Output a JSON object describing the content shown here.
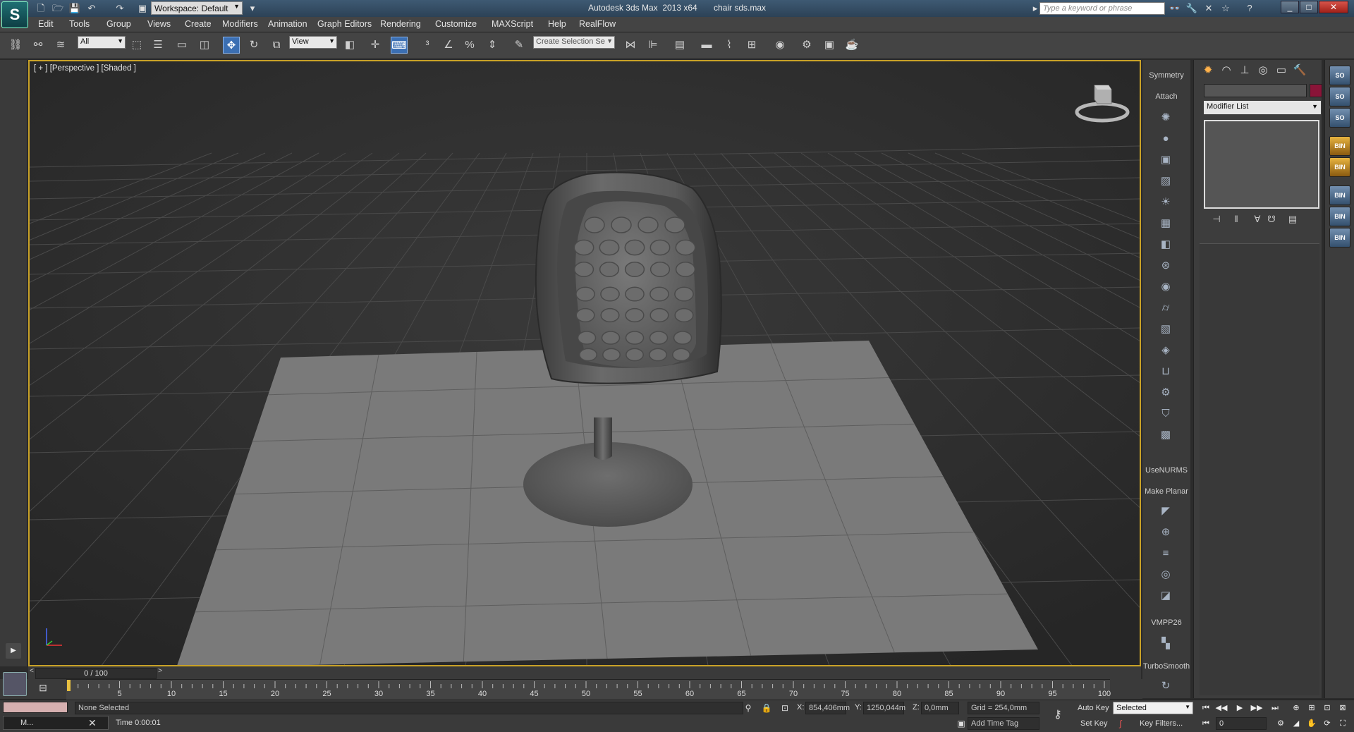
{
  "window": {
    "app_title": "Autodesk 3ds Max  2013 x64       chair sds.max",
    "workspace": "Workspace: Default",
    "search_placeholder": "Type a keyword or phrase"
  },
  "menu": [
    "Edit",
    "Tools",
    "Group",
    "Views",
    "Create",
    "Modifiers",
    "Animation",
    "Graph Editors",
    "Rendering",
    "Customize",
    "MAXScript",
    "Help",
    "RealFlow"
  ],
  "toolbar": {
    "selection_filter": "All",
    "reference_coord": "View",
    "named_selection": "Create Selection Se"
  },
  "viewport": {
    "label": "[ + ] [Perspective ] [Shaded ]",
    "border_color": "#c9a227",
    "grid_color": "#4a4a4a",
    "floor_color": "#7a7a7a",
    "chair_color": "#6e6e6e"
  },
  "modifier_buttons": {
    "symmetry": "Symmetry",
    "attach": "Attach",
    "usenurms": "UseNURMS",
    "make_planar": "Make Planar",
    "vmpp26": "VMPP26",
    "turbosmooth": "TurboSmooth"
  },
  "command_panel": {
    "modifier_list": "Modifier List",
    "object_color": "#8a1438"
  },
  "timeline": {
    "frame_display": "0 / 100",
    "ticks": [
      "5",
      "10",
      "15",
      "20",
      "25",
      "30",
      "35",
      "40",
      "45",
      "50",
      "55",
      "60",
      "65",
      "70",
      "75",
      "80",
      "85",
      "90",
      "95",
      "100"
    ]
  },
  "status": {
    "taskbar_label": "M...",
    "selection": "None Selected",
    "time": "Time  0:00:01",
    "x_label": "X:",
    "x_value": "854,406mm",
    "y_label": "Y:",
    "y_value": "1250,044m",
    "z_label": "Z:",
    "z_value": "0,0mm",
    "grid": "Grid = 254,0mm",
    "add_time_tag": "Add Time Tag",
    "auto_key": "Auto Key",
    "set_key": "Set Key",
    "key_mode": "Selected",
    "key_filters": "Key Filters...",
    "frame": "0"
  }
}
